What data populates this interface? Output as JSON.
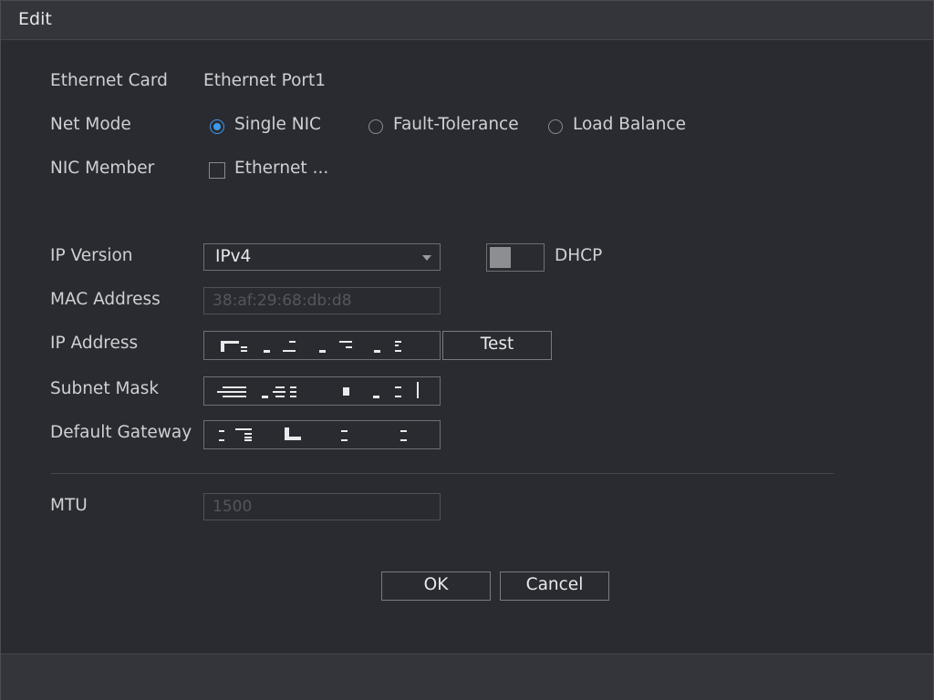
{
  "window": {
    "title": "Edit"
  },
  "form": {
    "ethernet_card": {
      "label": "Ethernet Card",
      "value": "Ethernet Port1"
    },
    "net_mode": {
      "label": "Net Mode",
      "options": [
        {
          "label": "Single NIC",
          "selected": true
        },
        {
          "label": "Fault-Tolerance",
          "selected": false
        },
        {
          "label": "Load Balance",
          "selected": false
        }
      ]
    },
    "nic_member": {
      "label": "NIC Member",
      "checkbox_label": "Ethernet ...",
      "checked": false
    },
    "ip_version": {
      "label": "IP Version",
      "value": "IPv4"
    },
    "dhcp": {
      "label": "DHCP",
      "enabled": false
    },
    "mac_address": {
      "label": "MAC Address",
      "value": "38:af:29:68:db:d8"
    },
    "ip_address": {
      "label": "IP Address",
      "test_label": "Test"
    },
    "subnet_mask": {
      "label": "Subnet Mask"
    },
    "default_gateway": {
      "label": "Default Gateway"
    },
    "mtu": {
      "label": "MTU",
      "value": "1500"
    }
  },
  "buttons": {
    "ok": "OK",
    "cancel": "Cancel"
  },
  "colors": {
    "background": "#2a2b31",
    "accent": "#3c9bf0",
    "titlebar": "#34353b"
  }
}
